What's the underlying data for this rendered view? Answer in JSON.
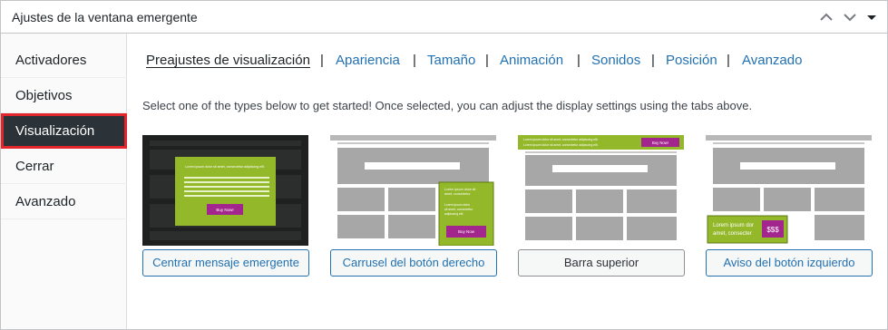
{
  "panel": {
    "title": "Ajustes de la ventana emergente"
  },
  "sidebar": {
    "items": [
      {
        "label": "Activadores"
      },
      {
        "label": "Objetivos"
      },
      {
        "label": "Visualización"
      },
      {
        "label": "Cerrar"
      },
      {
        "label": "Avanzado"
      }
    ]
  },
  "tabs": [
    {
      "label": "Preajustes de visualización"
    },
    {
      "label": "Apariencia"
    },
    {
      "label": "Tamaño"
    },
    {
      "label": "Animación"
    },
    {
      "label": "Sonidos"
    },
    {
      "label": "Posición"
    },
    {
      "label": "Avanzado"
    }
  ],
  "separator": "|",
  "intro": "Select one of the types below to get started! Once selected, you can adjust the display settings using the tabs above.",
  "presets": [
    {
      "label": "Centrar mensaje emergente",
      "thumb_text": "Lorem ipsum dolor sit amet, consectetur adipiscing elit. Lorem ipsum dolor sit amet, consectetur adipiscing elit. Lorem ipsum dolor sit amet, consectetur adipiscing elit.",
      "thumb_button": "Buy Now!"
    },
    {
      "label": "Carrusel del botón derecho",
      "thumb_text": "Lorem ipsum dolor sit amet, consectetur",
      "thumb_text2": "Lorem ipsum dolor sit amet, consectetur adipiscing elit.",
      "thumb_button": "Buy Now"
    },
    {
      "label": "Barra superior",
      "thumb_text": "Lorem ipsum dolor sit amet, consectetur adipiscing elit. Lorem ipsum dolor sit amet, consectetur adipiscing elit.",
      "thumb_button": "Buy Now!"
    },
    {
      "label": "Aviso del botón izquierdo",
      "thumb_text": "Lorem ipsum dolor sit amet, consecter",
      "thumb_button": "$$$"
    }
  ],
  "colors": {
    "accent": "#2271b1",
    "active_bg": "#2c3338",
    "highlight": "#e3262c",
    "lime": "#93b82a",
    "magenta": "#a3268f",
    "wire_gray": "#a7a7a7"
  }
}
